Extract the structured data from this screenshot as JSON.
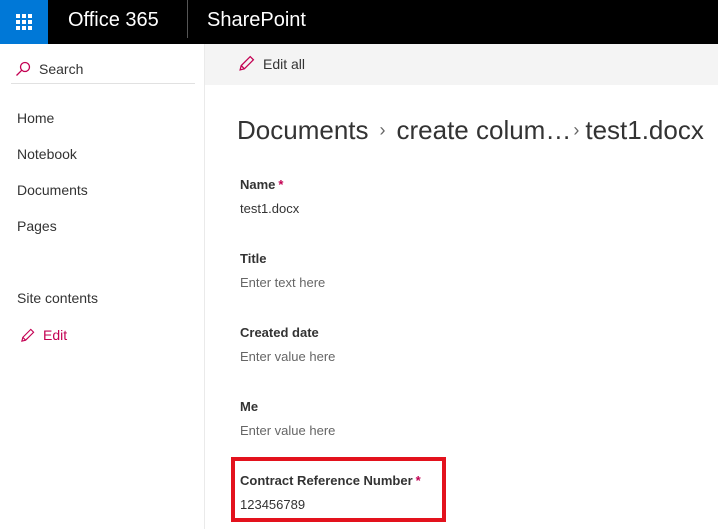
{
  "suite": {
    "brand": "Office 365",
    "app_name": "SharePoint"
  },
  "nav": {
    "search_label": "Search",
    "items": [
      {
        "label": "Home"
      },
      {
        "label": "Notebook"
      },
      {
        "label": "Documents"
      },
      {
        "label": "Pages"
      },
      {
        "label": "Site contents"
      }
    ],
    "edit_label": "Edit"
  },
  "command_bar": {
    "edit_all_label": "Edit all"
  },
  "breadcrumb": {
    "items": [
      "Documents",
      "create colum…",
      "test1.docx"
    ],
    "separator": "›"
  },
  "fields": [
    {
      "label": "Name",
      "required": "*",
      "value": "test1.docx"
    },
    {
      "label": "Title",
      "required": "",
      "value": "Enter text here"
    },
    {
      "label": "Created date",
      "required": "",
      "value": "Enter value here"
    },
    {
      "label": "Me",
      "required": "",
      "value": "Enter value here"
    },
    {
      "label": "Contract Reference Number",
      "required": "*",
      "value": "123456789"
    }
  ],
  "colors": {
    "suite_bg": "#000000",
    "waffle_bg": "#0078d7",
    "required": "#c30052",
    "highlight": "#e3121d"
  }
}
